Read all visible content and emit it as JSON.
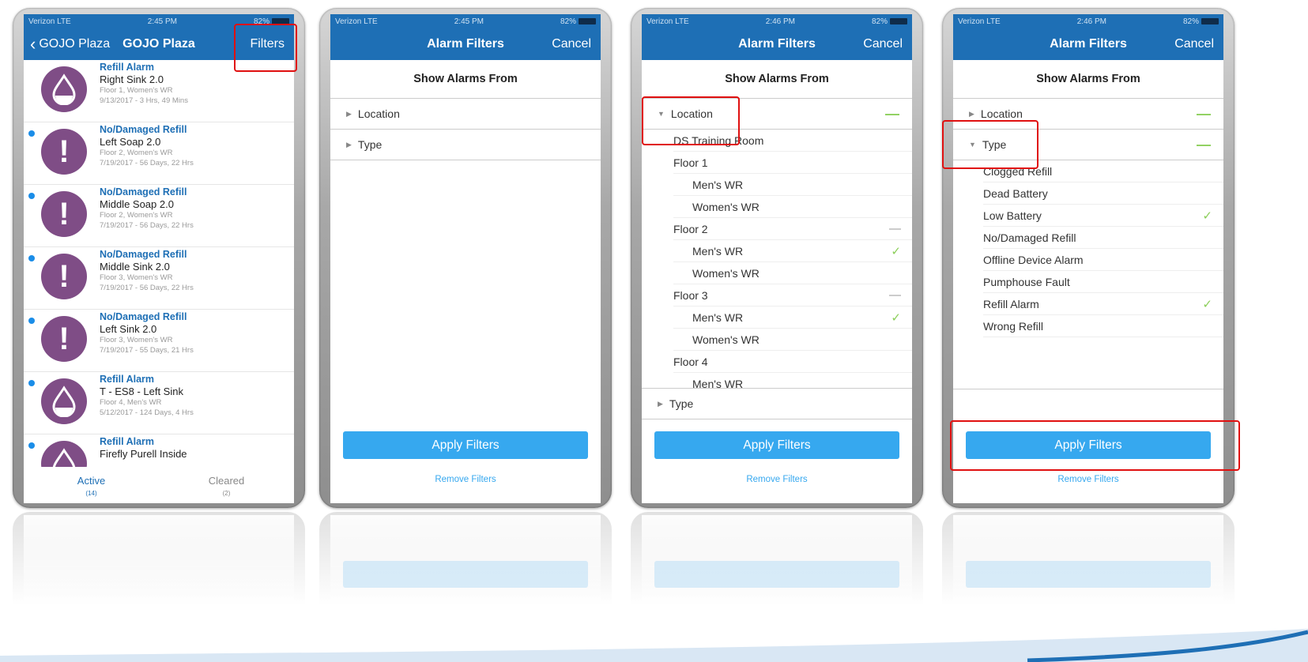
{
  "status": {
    "carrier": "Verizon LTE",
    "time1": "2:45 PM",
    "time3": "2:46 PM",
    "battery": "82%"
  },
  "phone1": {
    "back_label": "GOJO Plaza",
    "title": "GOJO Plaza",
    "filters_label": "Filters",
    "alarms": [
      {
        "type": "Refill Alarm",
        "name": "Right Sink 2.0",
        "location": "Floor 1, Women's WR",
        "time": "9/13/2017 - 3 Hrs, 49 Mins",
        "icon": "drop",
        "unread": false
      },
      {
        "type": "No/Damaged Refill",
        "name": "Left Soap 2.0",
        "location": "Floor 2, Women's WR",
        "time": "7/19/2017 - 56 Days, 22 Hrs",
        "icon": "exclamation",
        "unread": true
      },
      {
        "type": "No/Damaged Refill",
        "name": "Middle Soap 2.0",
        "location": "Floor 2, Women's WR",
        "time": "7/19/2017 - 56 Days, 22 Hrs",
        "icon": "exclamation",
        "unread": true
      },
      {
        "type": "No/Damaged Refill",
        "name": "Middle Sink 2.0",
        "location": "Floor 3, Women's WR",
        "time": "7/19/2017 - 56 Days, 22 Hrs",
        "icon": "exclamation",
        "unread": true
      },
      {
        "type": "No/Damaged Refill",
        "name": "Left Sink 2.0",
        "location": "Floor 3, Women's WR",
        "time": "7/19/2017 - 55 Days, 21 Hrs",
        "icon": "exclamation",
        "unread": true
      },
      {
        "type": "Refill Alarm",
        "name": "T - ES8 - Left Sink",
        "location": "Floor 4, Men's WR",
        "time": "5/12/2017 - 124 Days, 4 Hrs",
        "icon": "drop",
        "unread": true
      },
      {
        "type": "Refill Alarm",
        "name": "Firefly Purell Inside",
        "location": "",
        "time": "",
        "icon": "drop",
        "unread": true
      }
    ],
    "tabs": [
      {
        "label": "Active",
        "count": "(14)"
      },
      {
        "label": "Cleared",
        "count": "(2)"
      }
    ]
  },
  "filters": {
    "title": "Alarm Filters",
    "cancel_label": "Cancel",
    "header": "Show Alarms From",
    "location_label": "Location",
    "type_label": "Type",
    "apply_label": "Apply Filters",
    "remove_label": "Remove Filters"
  },
  "phone3": {
    "locations": [
      {
        "label": "DS Training Room",
        "indent": 0,
        "mark": ""
      },
      {
        "label": "Floor 1",
        "indent": 0,
        "mark": ""
      },
      {
        "label": "Men's WR",
        "indent": 1,
        "mark": ""
      },
      {
        "label": "Women's WR",
        "indent": 1,
        "mark": ""
      },
      {
        "label": "Floor 2",
        "indent": 0,
        "mark": "—"
      },
      {
        "label": "Men's WR",
        "indent": 1,
        "mark": "✓"
      },
      {
        "label": "Women's WR",
        "indent": 1,
        "mark": ""
      },
      {
        "label": "Floor 3",
        "indent": 0,
        "mark": "—"
      },
      {
        "label": "Men's WR",
        "indent": 1,
        "mark": "✓"
      },
      {
        "label": "Women's WR",
        "indent": 1,
        "mark": ""
      },
      {
        "label": "Floor 4",
        "indent": 0,
        "mark": ""
      },
      {
        "label": "Men's WR",
        "indent": 1,
        "mark": ""
      }
    ]
  },
  "phone4": {
    "types": [
      {
        "label": "Clogged Refill",
        "checked": false
      },
      {
        "label": "Dead Battery",
        "checked": false
      },
      {
        "label": "Low Battery",
        "checked": true
      },
      {
        "label": "No/Damaged Refill",
        "checked": false
      },
      {
        "label": "Offline Device Alarm",
        "checked": false
      },
      {
        "label": "Pumphouse Fault",
        "checked": false
      },
      {
        "label": "Refill Alarm",
        "checked": true
      },
      {
        "label": "Wrong Refill",
        "checked": false
      }
    ]
  },
  "colors": {
    "nav": "#1e6fb5",
    "button": "#36a8ef",
    "icon_bg": "#7f4d86",
    "check": "#8ccf5a",
    "highlight": "#e01010"
  }
}
